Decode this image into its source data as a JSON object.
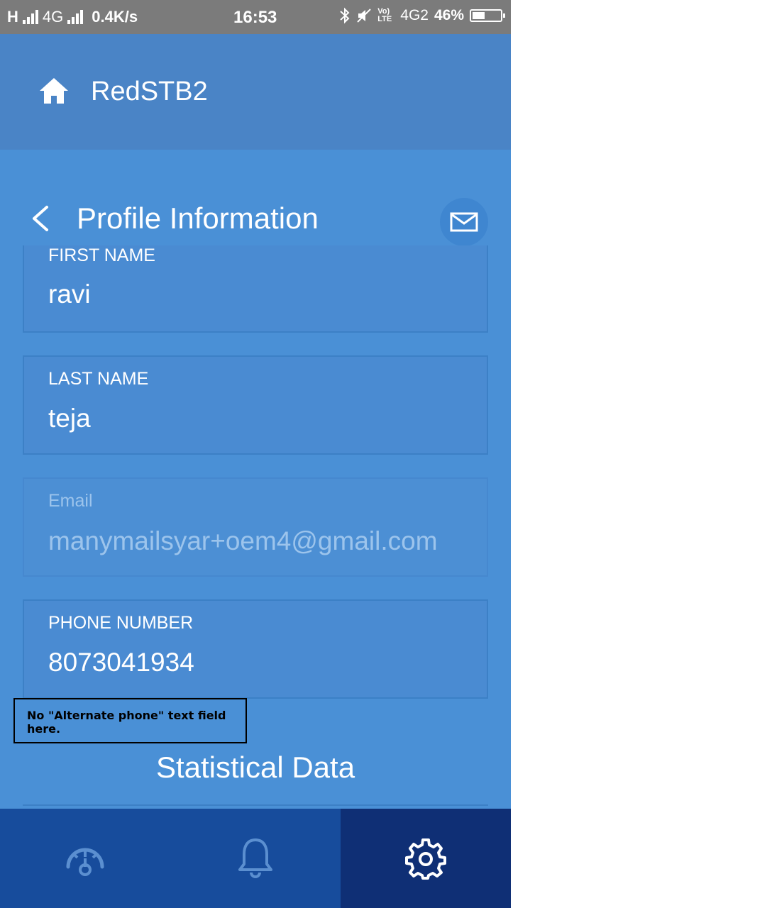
{
  "status_bar": {
    "network_left": "H",
    "network_4g": "4G",
    "speed": "0.4K/s",
    "time": "16:53",
    "volte": "Vo) LTE",
    "network_4g2": "4G2",
    "battery": "46%"
  },
  "app_bar": {
    "title": "RedSTB2",
    "home_icon": "home-icon"
  },
  "page": {
    "title": "Profile Information",
    "back_icon": "chevron-left-icon",
    "mail_icon": "mail-icon"
  },
  "form": {
    "first_name": {
      "label": "FIRST NAME",
      "value": "ravi"
    },
    "last_name": {
      "label": "LAST NAME",
      "value": "teja"
    },
    "email": {
      "label": "Email",
      "value": "manymailsyar+oem4@gmail.com",
      "disabled": true
    },
    "phone": {
      "label": "PHONE NUMBER",
      "value": "8073041934"
    }
  },
  "annotation": {
    "text": "No \"Alternate phone\" text field here."
  },
  "statistical": {
    "title": "Statistical Data"
  },
  "bottom_nav": {
    "tabs": [
      {
        "icon": "speedometer-icon",
        "active": false
      },
      {
        "icon": "bell-icon",
        "active": false
      },
      {
        "icon": "gear-icon",
        "active": true
      }
    ]
  },
  "colors": {
    "background": "#4a90d6",
    "app_bar": "#4a84c6",
    "bottom_nav": "#174c9c",
    "bottom_nav_active": "#0f2f75",
    "status_bar": "#7b7b7b"
  }
}
